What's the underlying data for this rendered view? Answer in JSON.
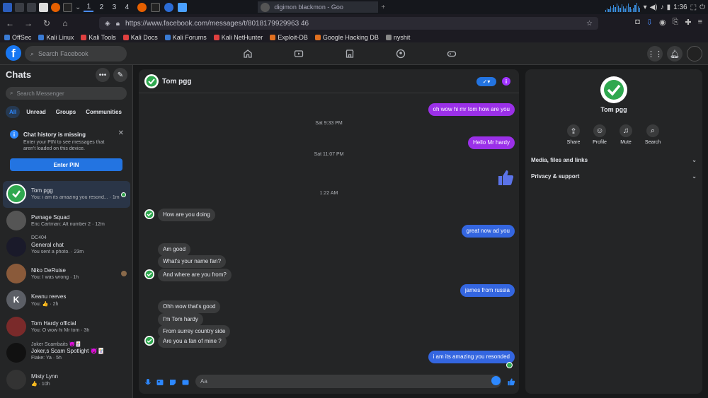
{
  "system_bar": {
    "workspaces": [
      "1",
      "2",
      "3",
      "4"
    ],
    "window_title_1": "",
    "window_title_2": "digimon blackmon - Goo",
    "new_tab": "+",
    "clock": "1:36",
    "accent": "#3a8fe0"
  },
  "browser": {
    "url": "https://www.facebook.com/messages/t/8018179929963 46",
    "bookmarks": [
      "OffSec",
      "Kali Linux",
      "Kali Tools",
      "Kali Docs",
      "Kali Forums",
      "Kali NetHunter",
      "Exploit-DB",
      "Google Hacking DB",
      "nyshit"
    ]
  },
  "facebook": {
    "logo": "f",
    "search_placeholder": "Search Facebook",
    "brand_color": "#1877f2"
  },
  "sidebar": {
    "title": "Chats",
    "search_placeholder": "Search Messenger",
    "filters": [
      "All",
      "Unread",
      "Groups",
      "Communities"
    ],
    "notice_title": "Chat history is missing",
    "notice_desc": "Enter your PIN to see messages that aren't loaded on this device.",
    "notice_button": "Enter PIN",
    "chats": [
      {
        "pre": "",
        "name": "Tom pgg",
        "preview": "You: i am its amazing you resond... · 1m"
      },
      {
        "pre": "",
        "name": "Pwnage Squad",
        "preview": "Eric Cartman: Alt number 2 · 12m"
      },
      {
        "pre": "DC404",
        "name": "General chat",
        "preview": "You sent a photo. · 23m"
      },
      {
        "pre": "",
        "name": "Niko DeRuise",
        "preview": "You: I was wrong · 1h"
      },
      {
        "pre": "",
        "name": "Keanu reeves",
        "preview": "You: 👍 · 2h"
      },
      {
        "pre": "",
        "name": "Tom Hardy official",
        "preview": "You: O wow hi Mr tom · 3h"
      },
      {
        "pre": "Joker Scambaits 😈🃏",
        "name": "Joker,s Scam Spotlight 😈🃏",
        "preview": "Flake: Ya · 5h"
      },
      {
        "pre": "",
        "name": "Misty Lynn",
        "preview": "👍 · 10h"
      }
    ]
  },
  "conversation": {
    "name": "Tom pgg",
    "input_placeholder": "Aa",
    "messages": [
      {
        "who": "out",
        "text": "oh wow hi mr tom how are you"
      },
      {
        "who": "ts",
        "text": "Sat 9:33 PM"
      },
      {
        "who": "out",
        "text": "Hello Mr hardy"
      },
      {
        "who": "ts",
        "text": "Sat 11:07 PM"
      },
      {
        "who": "ts",
        "text": "1:22 AM"
      },
      {
        "who": "in",
        "text": "How are you doing"
      },
      {
        "who": "out",
        "text": "great now ad you"
      },
      {
        "who": "in",
        "text": "Am good"
      },
      {
        "who": "in",
        "text": "What's your name fan?"
      },
      {
        "who": "in",
        "text": "And where are you from?"
      },
      {
        "who": "out",
        "text": "james from russia"
      },
      {
        "who": "in",
        "text": "Ohh wow that's good"
      },
      {
        "who": "in",
        "text": "I'm Tom hardy"
      },
      {
        "who": "in",
        "text": "From surrey country side"
      },
      {
        "who": "in",
        "text": "Are you a fan of mine ?"
      },
      {
        "who": "out",
        "text": "i am its amazing you resonded"
      }
    ],
    "colors": {
      "outgoing_top": "#9b30e8",
      "outgoing_bottom": "#3466e0",
      "incoming": "#3a3b3c"
    }
  },
  "details": {
    "name": "Tom pgg",
    "actions": [
      "Share",
      "Profile",
      "Mute",
      "Search"
    ],
    "sections": [
      "Media, files and links",
      "Privacy & support"
    ]
  }
}
